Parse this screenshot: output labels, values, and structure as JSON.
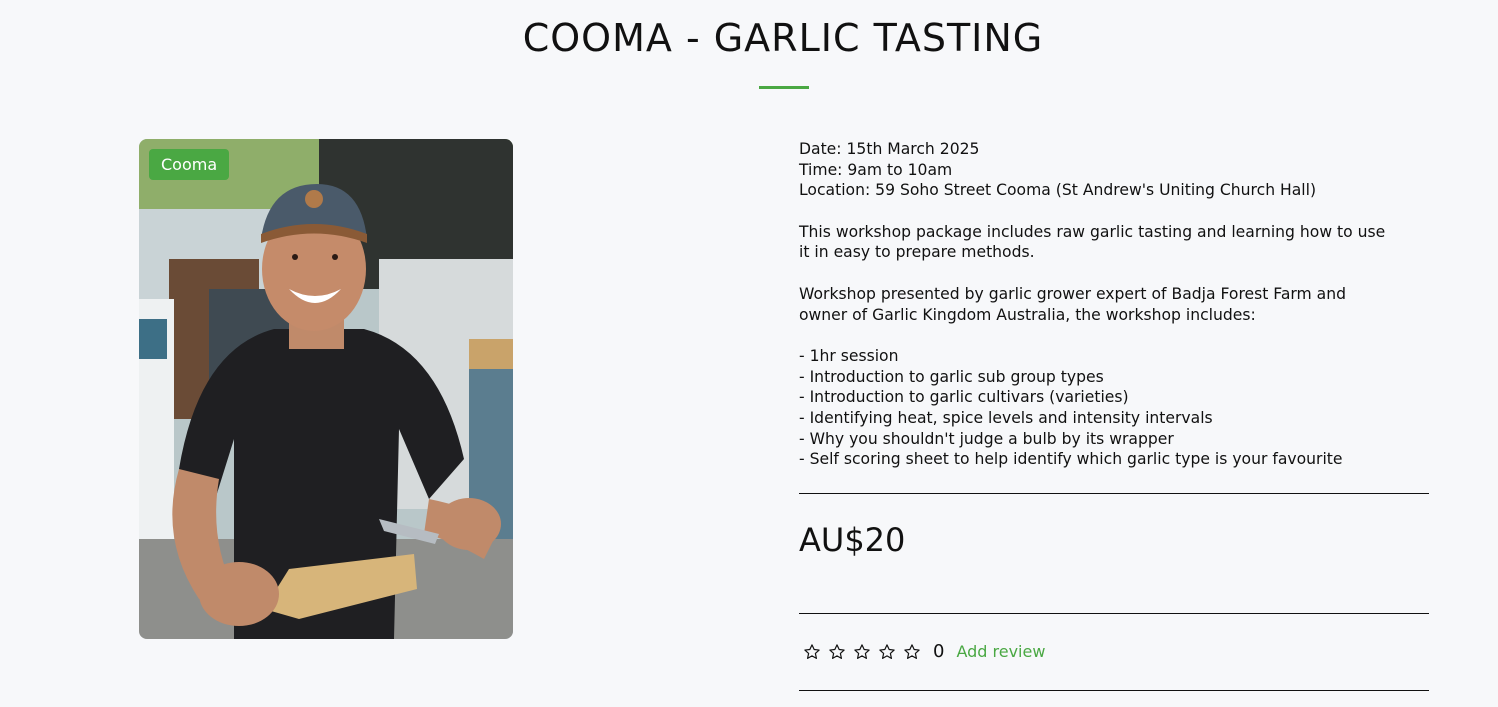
{
  "product": {
    "title": "COOMA - GARLIC TASTING",
    "badge": "Cooma",
    "accent_color": "#4aa843",
    "details": {
      "date": "Date: 15th March 2025",
      "time": "Time: 9am to 10am",
      "location": "Location: 59 Soho Street Cooma (St Andrew's Uniting Church Hall)",
      "para1_line1": "This workshop package includes raw garlic tasting and learning how to use",
      "para1_line2": "it in easy to prepare methods.",
      "para2_line1": "Workshop presented by garlic grower expert of Badja Forest Farm and",
      "para2_line2": "owner of Garlic Kingdom Australia, the workshop includes:",
      "bullets": [
        "- 1hr session",
        "- Introduction to garlic sub group types",
        "- Introduction to garlic cultivars (varieties)",
        "- Identifying heat, spice levels and intensity intervals",
        "- Why you shouldn't judge a bulb by its wrapper",
        "- Self scoring sheet to help identify which garlic type is your favourite"
      ]
    },
    "price": "AU$20",
    "rating": {
      "stars_filled": 0,
      "stars_total": 5,
      "count": "0",
      "add_review_label": "Add review",
      "star_icon": "star-outline-icon"
    }
  }
}
